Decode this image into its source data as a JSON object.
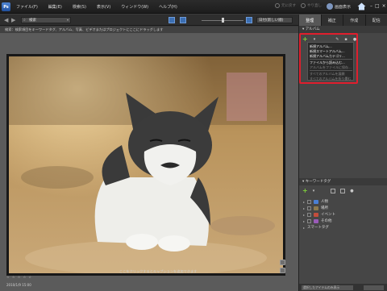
{
  "app": {
    "logo": "Ps"
  },
  "menu": [
    "ファイル(F)",
    "編集(E)",
    "検索(S)",
    "表示(V)",
    "ウィンドウ(W)",
    "ヘルプ(H)"
  ],
  "history": {
    "undo": "元に戻す",
    "redo": "やり直し"
  },
  "user": {
    "label": "画面表示"
  },
  "toolbar": {
    "search_value": "検索",
    "sort_value": "日付(新しい順)"
  },
  "hint": "検索：検索項目をキーワードタグ、アルバム、写真、ビデオまたはプロジェクトにここにドラッグします",
  "panel": {
    "tabs": [
      {
        "label": "整理"
      },
      {
        "label": "補正"
      },
      {
        "label": "作成"
      },
      {
        "label": "配信"
      }
    ],
    "album_header": "アルバム",
    "album_menu": [
      {
        "label": "新規アルバム...",
        "enabled": true
      },
      {
        "label": "新規スマートアルバム...",
        "enabled": true
      },
      {
        "label": "新規アルバムカテゴリ...",
        "enabled": true
      },
      {
        "label": "ファイルから読み込む...",
        "enabled": true
      },
      {
        "label": "アルバムをファイルに保存...",
        "enabled": false
      },
      {
        "label": "すべてのアルバムを展開",
        "enabled": false
      },
      {
        "label": "すべてのアルバムを折り畳む",
        "enabled": false
      }
    ],
    "keyword_header": "キーワードタグ",
    "keywords": [
      {
        "label": "人物",
        "color": "#4a7fd4"
      },
      {
        "label": "場所",
        "color": "#8e7a4e"
      },
      {
        "label": "イベント",
        "color": "#c44d3c"
      },
      {
        "label": "その他",
        "color": "#9a5bb8"
      },
      {
        "label": "スマートタグ",
        "color": ""
      }
    ],
    "footer_select": "選択したアイテムのみ表示"
  },
  "photo": {
    "caption": "ここをクリックするとキャプションを追加できます",
    "rating": "☆ ☆ ☆ ☆ ☆",
    "date": "2010/1/9 15:00"
  }
}
